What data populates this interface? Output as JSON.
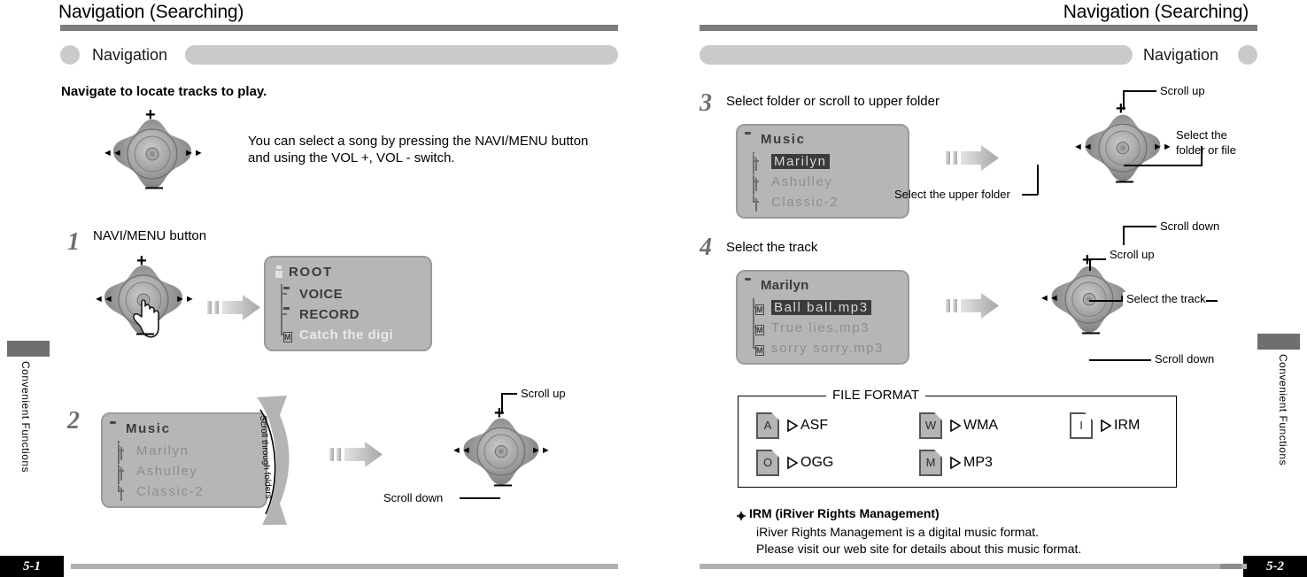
{
  "left_page": {
    "header_title": "Navigation (Searching)",
    "nav_label": "Navigation",
    "section_heading": "Navigate to locate tracks to play.",
    "intro_text": "You can select a song by pressing the NAVI/MENU button and using the VOL +, VOL - switch.",
    "side_tab_text": "Convenient Functions",
    "page_number": "5-1",
    "steps": [
      {
        "number": "1",
        "label": "NAVI/MENU button",
        "lcd": {
          "title": "ROOT",
          "title_icon": "disk-icon",
          "items": [
            {
              "text": "VOICE",
              "icon": "folder-icon",
              "selected": false
            },
            {
              "text": "RECORD",
              "icon": "folder-icon",
              "selected": false
            },
            {
              "text": "Catch the digi",
              "icon": "mp3-file-icon",
              "selected": true
            }
          ]
        }
      },
      {
        "number": "2",
        "label": "",
        "curve_label": "Scroll through folders",
        "scroll_up_label": "Scroll up",
        "scroll_down_label": "Scroll down",
        "lcd": {
          "title": "Music",
          "title_icon": "folder-icon",
          "items": [
            {
              "text": "Marilyn",
              "icon": "file-icon",
              "selected": false
            },
            {
              "text": "Ashulley",
              "icon": "file-icon",
              "selected": false
            },
            {
              "text": "Classic-2",
              "icon": "file-icon",
              "selected": false
            }
          ]
        }
      }
    ]
  },
  "right_page": {
    "header_title": "Navigation (Searching)",
    "nav_label": "Navigation",
    "side_tab_text": "Convenient Functions",
    "page_number": "5-2",
    "steps": [
      {
        "number": "3",
        "label": "Select folder or scroll to upper folder",
        "callouts": {
          "scroll_up": "Scroll up",
          "scroll_down": "Scroll down",
          "right": "Select the\nfolder or file",
          "right_line1": "Select the",
          "right_line2": "folder or file",
          "left": "Select the upper folder"
        },
        "lcd": {
          "title": "Music",
          "title_icon": "folder-icon",
          "items": [
            {
              "text": "Marilyn",
              "icon": "file-icon",
              "selected": true
            },
            {
              "text": "Ashulley",
              "icon": "file-icon",
              "selected": false
            },
            {
              "text": "Classic-2",
              "icon": "file-icon",
              "selected": false
            }
          ]
        }
      },
      {
        "number": "4",
        "label": "Select the track",
        "callouts": {
          "scroll_up": "Scroll up",
          "scroll_down": "Scroll down",
          "right": "Select the track"
        },
        "lcd": {
          "title": "Marilyn",
          "title_icon": "folder-icon",
          "items": [
            {
              "text": "Ball ball.mp3",
              "icon": "mp3-file-icon",
              "selected": true
            },
            {
              "text": "True lies.mp3",
              "icon": "mp3-file-icon",
              "selected": false
            },
            {
              "text": "sorry sorry.mp3",
              "icon": "mp3-file-icon",
              "selected": false
            }
          ]
        }
      }
    ],
    "file_format": {
      "title": "FILE FORMAT",
      "items": [
        {
          "letter": "A",
          "label": "ASF",
          "blank": false
        },
        {
          "letter": "O",
          "label": "OGG",
          "blank": false
        },
        {
          "letter": "W",
          "label": "WMA",
          "blank": false
        },
        {
          "letter": "M",
          "label": "MP3",
          "blank": false
        },
        {
          "letter": "I",
          "label": "IRM",
          "blank": true
        }
      ]
    },
    "note": {
      "title": "IRM (iRiver Rights Management)",
      "line1": "iRiver Rights Management is a digital music format.",
      "line2": "Please visit our web site for details about this music format."
    }
  },
  "colors": {
    "rule_gray": "#7d7d7d",
    "navbar_gray": "#cacaca",
    "lcd_bg": "#b6b6b6",
    "lcd_sel": "#3b3b3b",
    "step_num": "#6f6f6f"
  }
}
